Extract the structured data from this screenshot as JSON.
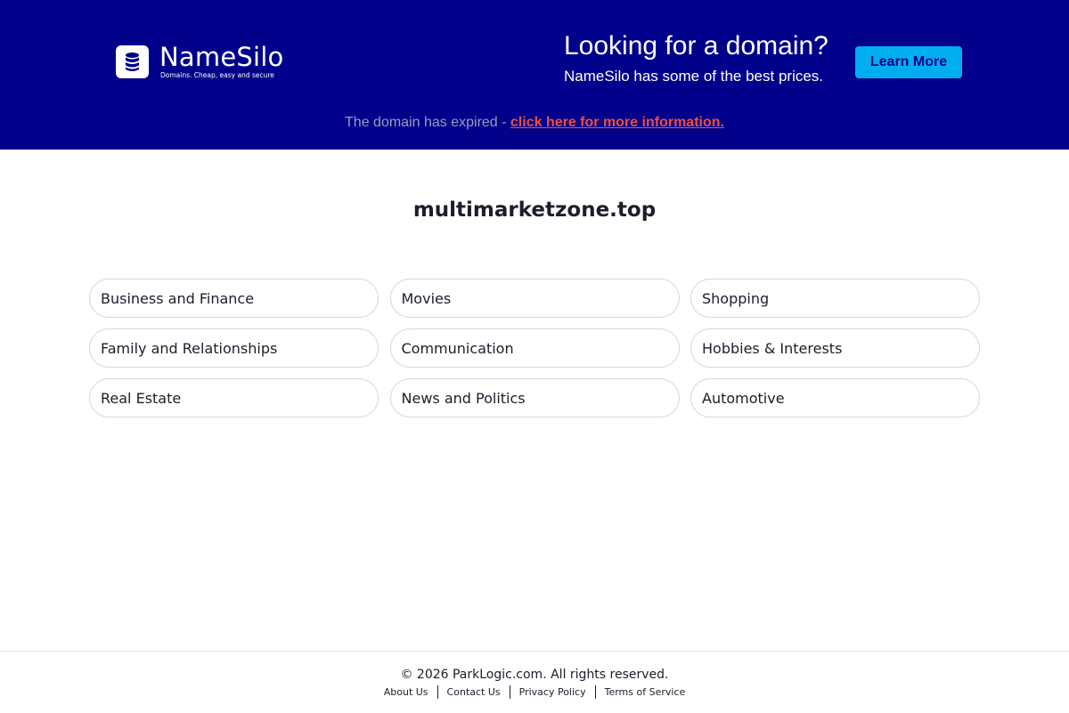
{
  "banner": {
    "logo": {
      "name": "NameSilo",
      "tagline": "Domains. Cheap, easy and secure",
      "icon": "database-stack-icon"
    },
    "promo_title": "Looking for a domain?",
    "promo_subtitle": "NameSilo has some of the best prices.",
    "learn_more_label": "Learn More",
    "expired_text": "The domain has expired - ",
    "expired_link": "click here for more information.",
    "colors": {
      "background": "#00008b",
      "button": "#00aeef",
      "link": "#f04e3e"
    }
  },
  "domain": "multimarketzone.top",
  "categories": [
    "Business and Finance",
    "Movies",
    "Shopping",
    "Family and Relationships",
    "Communication",
    "Hobbies & Interests",
    "Real Estate",
    "News and Politics",
    "Automotive"
  ],
  "footer": {
    "copyright": "© 2026 ParkLogic.com. All rights reserved.",
    "links": [
      "About Us",
      "Contact Us",
      "Privacy Policy",
      "Terms of Service"
    ]
  }
}
